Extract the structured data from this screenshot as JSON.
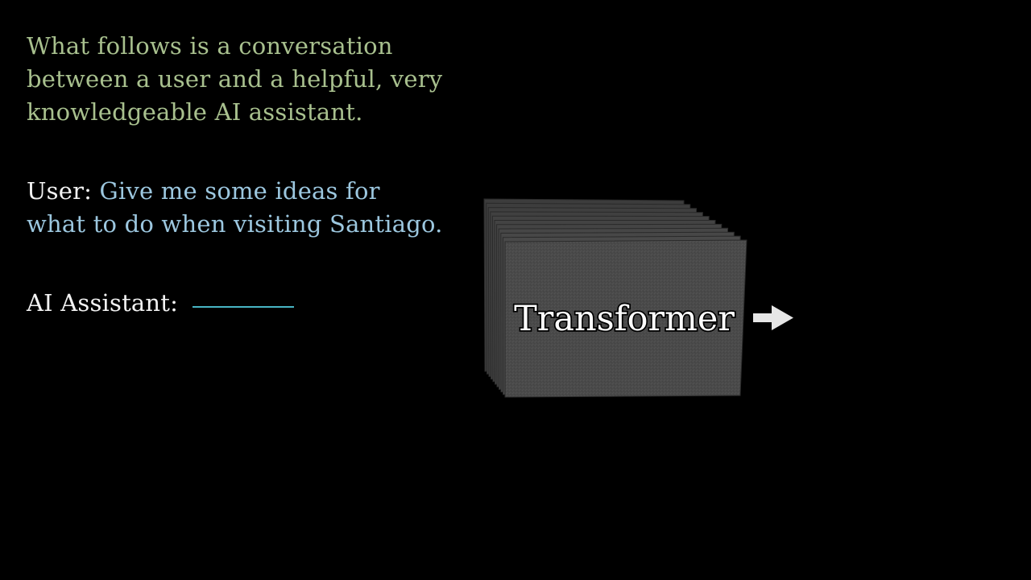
{
  "system_prompt": {
    "text": "What follows is a conversation between a user and a helpful, very knowledgeable AI assistant."
  },
  "user_turn": {
    "speaker": "User:",
    "message": "Give me some ideas for what to do when visiting Santiago."
  },
  "assistant_turn": {
    "speaker": "AI Assistant:"
  },
  "diagram": {
    "box_label": "Transformer",
    "arrow_icon": "arrow-right-icon"
  },
  "colors": {
    "background": "#000000",
    "system_prompt_text": "#a8c08e",
    "user_message_text": "#9cc7df",
    "speaker_text": "#f2f2f2",
    "answer_blank": "#48b5c4",
    "box_face": "#4a4a4a"
  }
}
